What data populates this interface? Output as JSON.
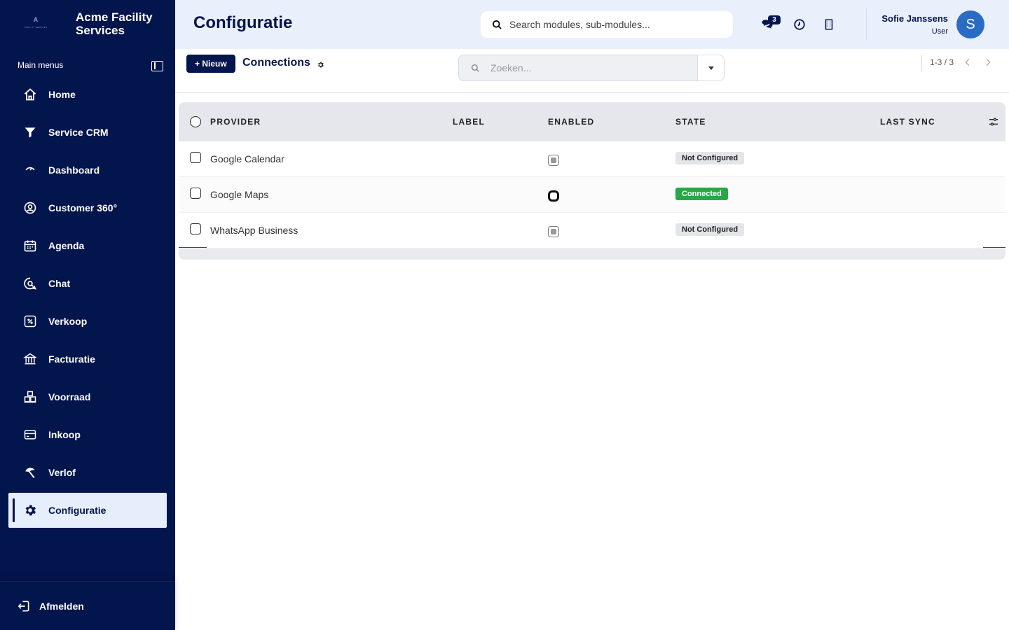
{
  "brand": {
    "logo_letter": "A",
    "logo_sub": "FACILITY SERVICES",
    "name": "Acme Facility Services"
  },
  "sidebar": {
    "header": "Main menus",
    "items": [
      {
        "label": "Home",
        "icon": "home-icon"
      },
      {
        "label": "Service CRM",
        "icon": "filter-icon"
      },
      {
        "label": "Dashboard",
        "icon": "gauge-icon"
      },
      {
        "label": "Customer 360°",
        "icon": "user-circle-icon"
      },
      {
        "label": "Agenda",
        "icon": "calendar-icon"
      },
      {
        "label": "Chat",
        "icon": "chat-search-icon"
      },
      {
        "label": "Verkoop",
        "icon": "percent-tag-icon"
      },
      {
        "label": "Facturatie",
        "icon": "bank-icon"
      },
      {
        "label": "Voorraad",
        "icon": "warehouse-icon"
      },
      {
        "label": "Inkoop",
        "icon": "credit-card-icon"
      },
      {
        "label": "Verlof",
        "icon": "beach-icon"
      },
      {
        "label": "Configuratie",
        "icon": "gear-icon",
        "active": true
      }
    ],
    "logout_label": "Afmelden"
  },
  "topbar": {
    "title": "Configuratie",
    "search_placeholder": "Search modules, sub-modules...",
    "chat_badge": "3",
    "user_name": "Sofie Janssens",
    "user_role": "User",
    "avatar_initial": "S"
  },
  "control": {
    "new_label": "+ Nieuw",
    "view_title": "Connections",
    "search_placeholder": "Zoeken...",
    "pager": "1-3 / 3"
  },
  "table": {
    "columns": [
      "PROVIDER",
      "LABEL",
      "ENABLED",
      "STATE",
      "LAST SYNC"
    ],
    "rows": [
      {
        "provider": "Google Calendar",
        "label": "",
        "enabled": false,
        "state": "Not Configured",
        "last_sync": ""
      },
      {
        "provider": "Google Maps",
        "label": "",
        "enabled": true,
        "state": "Connected",
        "last_sync": ""
      },
      {
        "provider": "WhatsApp Business",
        "label": "",
        "enabled": false,
        "state": "Not Configured",
        "last_sync": ""
      }
    ]
  },
  "colors": {
    "sidebar_bg": "#03154d",
    "topbar_bg": "#eaf0fb",
    "connected": "#28a745",
    "avatar": "#2a6bc4"
  }
}
